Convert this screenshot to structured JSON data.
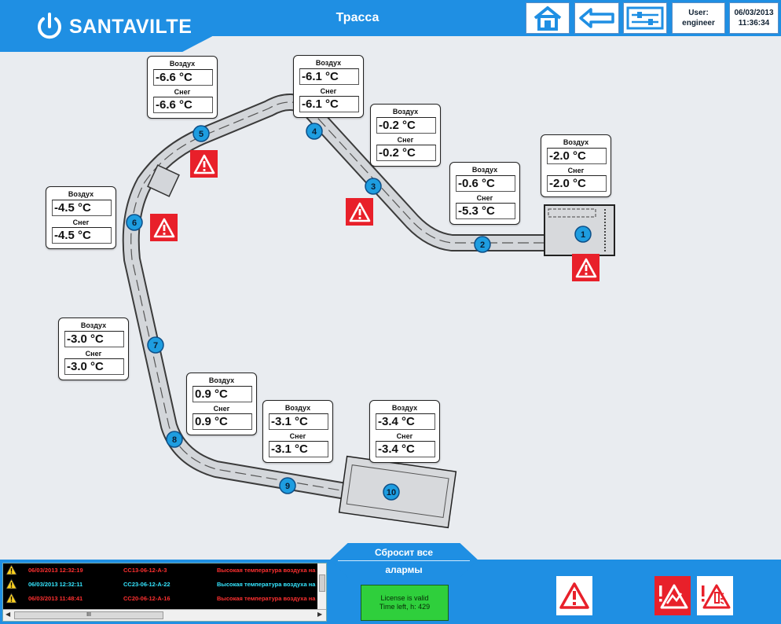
{
  "header": {
    "brand": "SANTAVILTE",
    "title": "Трасса",
    "user_label": "User:",
    "user_name": "engineer",
    "date": "06/03/2013",
    "time": "11:36:34"
  },
  "colors": {
    "header": "#1f8fe3",
    "node": "#1e9de0",
    "alarm": "#e8202a",
    "license": "#2fcf3c"
  },
  "icons": [
    "home-icon",
    "back-arrow-icon",
    "settings-sliders-icon",
    "warning-triangle-icon"
  ],
  "nodes": [
    "1",
    "2",
    "3",
    "4",
    "5",
    "6",
    "7",
    "8",
    "9",
    "10"
  ],
  "sensors": [
    {
      "air_label": "Воздух",
      "air": "-6.6 °C",
      "snow_label": "Снег",
      "snow": "-6.6 °C"
    },
    {
      "air_label": "Воздух",
      "air": "-6.1 °C",
      "snow_label": "Снег",
      "snow": "-6.1 °C"
    },
    {
      "air_label": "Воздух",
      "air": "-0.2 °C",
      "snow_label": "Снег",
      "snow": "-0.2 °C"
    },
    {
      "air_label": "Воздух",
      "air": "-2.0 °C",
      "snow_label": "Снег",
      "snow": "-2.0 °C"
    },
    {
      "air_label": "Воздух",
      "air": "-0.6 °C",
      "snow_label": "Снег",
      "snow": "-5.3 °C"
    },
    {
      "air_label": "Воздух",
      "air": "-4.5 °C",
      "snow_label": "Снег",
      "snow": "-4.5 °C"
    },
    {
      "air_label": "Воздух",
      "air": "-3.0 °C",
      "snow_label": "Снег",
      "snow": "-3.0 °C"
    },
    {
      "air_label": "Воздух",
      "air": "0.9 °C",
      "snow_label": "Снег",
      "snow": "0.9 °C"
    },
    {
      "air_label": "Воздух",
      "air": "-3.1 °C",
      "snow_label": "Снег",
      "snow": "-3.1 °C"
    },
    {
      "air_label": "Воздух",
      "air": "-3.4 °C",
      "snow_label": "Снег",
      "snow": "-3.4 °C"
    }
  ],
  "footer": {
    "reset_line1": "Сбросит все",
    "reset_line2": "алармы",
    "license_line1": "License is valid",
    "license_line2": "Time left, h: 429",
    "scroll_thumb": "III",
    "log": [
      {
        "time": "06/03/2013 12:32:19",
        "tag": "CC13-06-12-A-3",
        "message": "Высокая температура воздуха на",
        "color": "#ff3030"
      },
      {
        "time": "06/03/2013 12:32:11",
        "tag": "CC23-06-12-A-22",
        "message": "Высокая температура воздуха на",
        "color": "#35e6ff"
      },
      {
        "time": "06/03/2013 11:48:41",
        "tag": "CC20-06-12-A-16",
        "message": "Высокая температура воздуха на",
        "color": "#ff3030"
      }
    ]
  }
}
